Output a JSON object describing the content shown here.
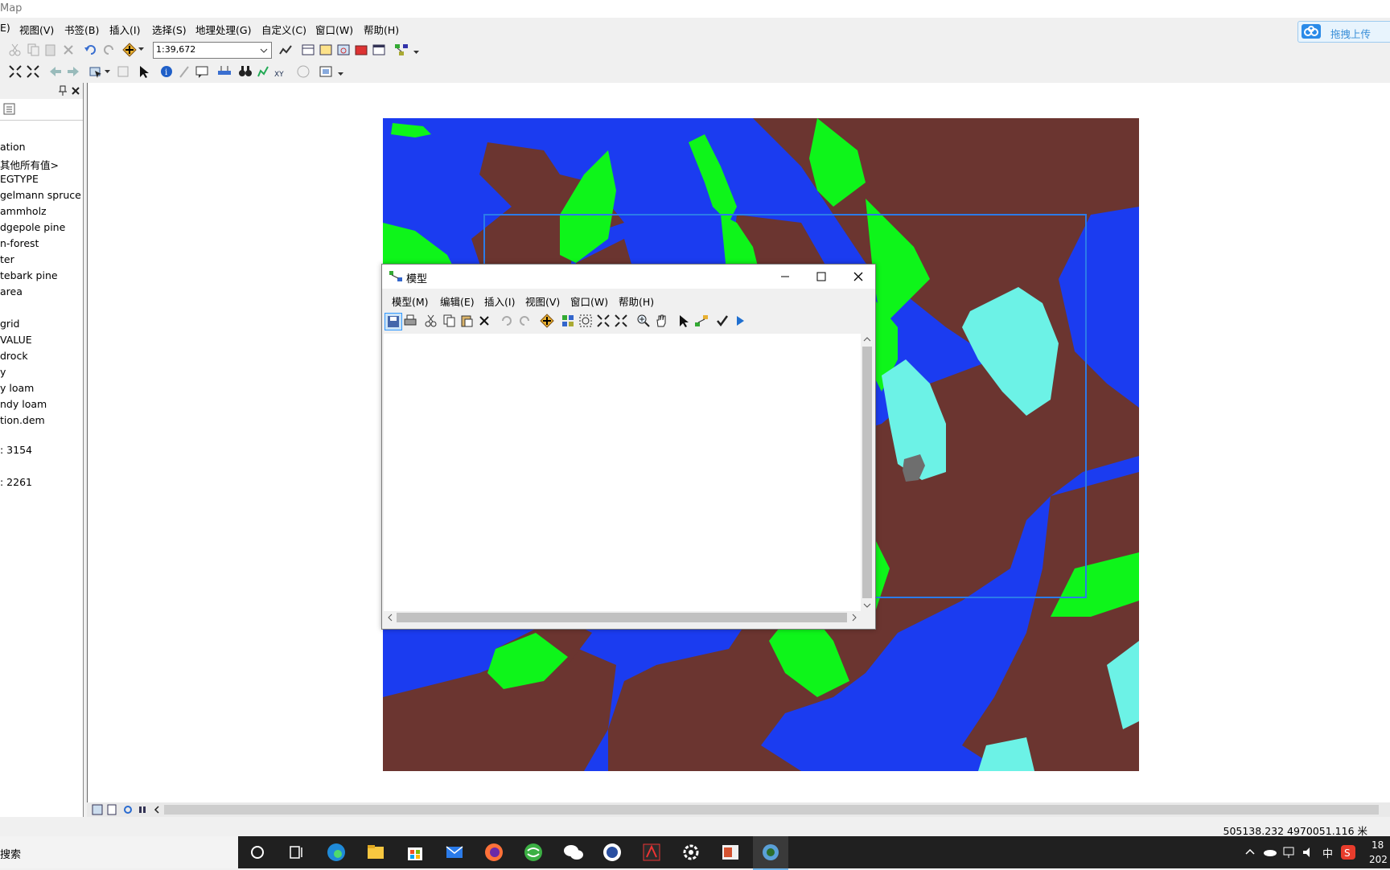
{
  "app": {
    "title": "Map"
  },
  "menu": [
    "E)",
    "视图(V)",
    "书签(B)",
    "插入(I)",
    "选择(S)",
    "地理处理(G)",
    "自定义(C)",
    "窗口(W)",
    "帮助(H)"
  ],
  "toolbar": {
    "scale": "1:39,672"
  },
  "baidu": {
    "label": "拖拽上传"
  },
  "toc": {
    "items": [
      "ation",
      "其他所有值>",
      "EGTYPE",
      "gelmann spruce",
      "ammholz",
      "dgepole pine",
      "n-forest",
      "ter",
      "tebark pine",
      "area",
      "grid",
      "VALUE",
      "drock",
      "y",
      "y loam",
      "ndy loam",
      "tion.dem",
      ": 3154",
      ": 2261"
    ]
  },
  "status": {
    "coords": "505138.232  4970051.116 米"
  },
  "taskbar": {
    "search": "搜索",
    "tray_ime": "中",
    "clock_line1": "18",
    "clock_line2": "202"
  },
  "dialog": {
    "title": "模型",
    "menu": [
      "模型(M)",
      "编辑(E)",
      "插入(I)",
      "视图(V)",
      "窗口(W)",
      "帮助(H)"
    ]
  },
  "colors": {
    "brown": "#6b3530",
    "blue": "#1b3cf0",
    "green": "#0ef51a",
    "cyan": "#6cf2e6",
    "selection": "#2b7be9"
  }
}
